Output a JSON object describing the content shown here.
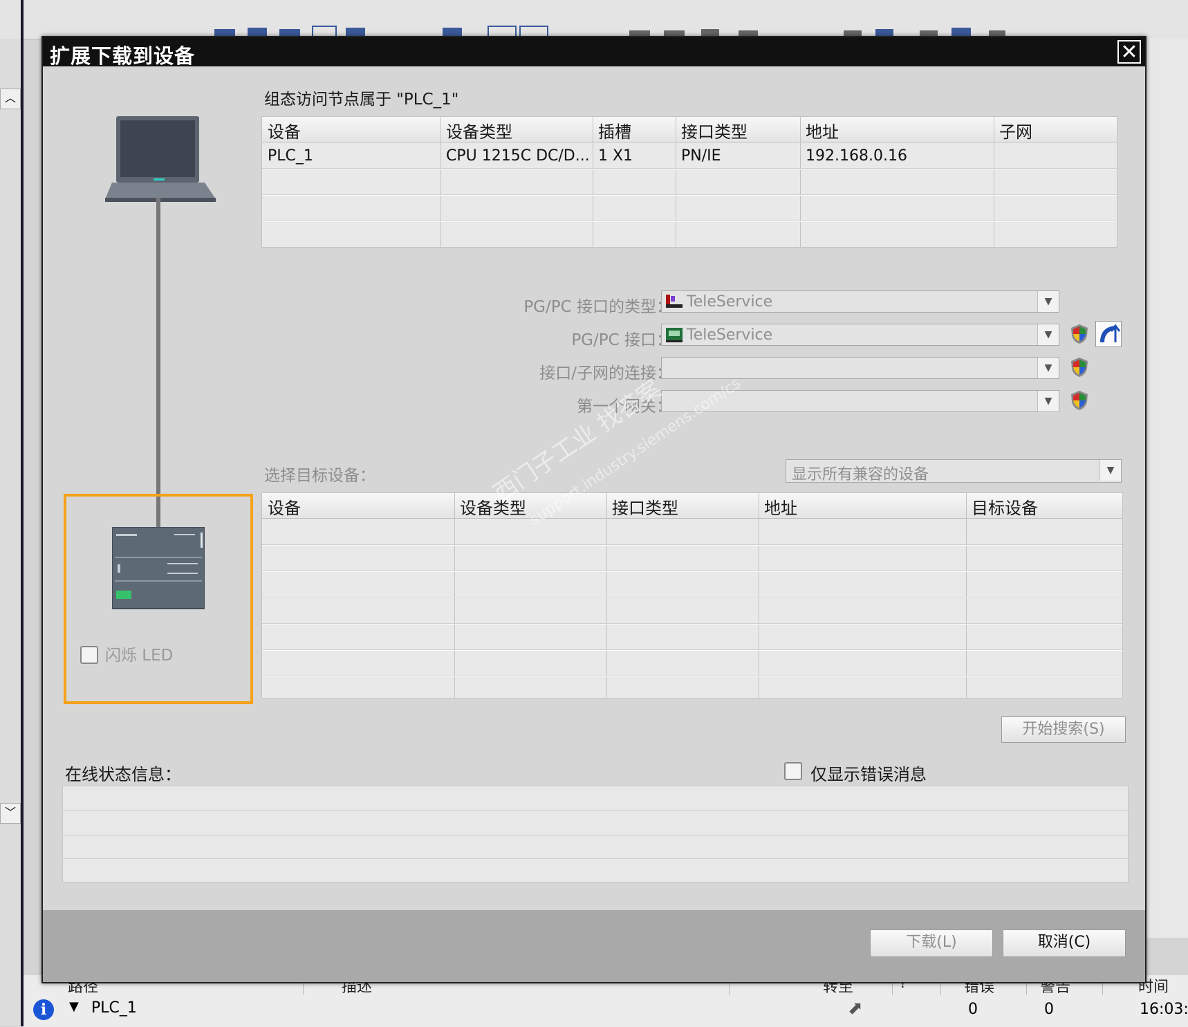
{
  "dialog": {
    "title": "扩展下载到设备",
    "close_glyph": "✕"
  },
  "config_section": {
    "heading": "组态访问节点属于 \"PLC_1\"",
    "columns": [
      "设备",
      "设备类型",
      "插槽",
      "接口类型",
      "地址",
      "子网"
    ],
    "rows": [
      [
        "PLC_1",
        "CPU 1215C DC/D...",
        "1 X1",
        "PN/IE",
        "192.168.0.16",
        ""
      ]
    ]
  },
  "interface": {
    "pgpc_type_label": "PG/PC 接口的类型：",
    "pgpc_type_value": "TeleService",
    "pgpc_label": "PG/PC 接口：",
    "pgpc_value": "TeleService",
    "subnet_label": "接口/子网的连接：",
    "subnet_value": "",
    "gateway_label": "第一个网关：",
    "gateway_value": ""
  },
  "target_section": {
    "label": "选择目标设备：",
    "filter_value": "显示所有兼容的设备",
    "columns": [
      "设备",
      "设备类型",
      "接口类型",
      "地址",
      "目标设备"
    ],
    "rows": []
  },
  "plc_panel": {
    "led_label": "闪烁 LED"
  },
  "search_button": "开始搜索(S)",
  "online_section": {
    "label": "在线状态信息：",
    "errors_only_label": "仅显示错误消息"
  },
  "footer": {
    "download_button": "下载(L)",
    "cancel_button": "取消(C)"
  },
  "watermark": {
    "line1": "西门子工业 找答案",
    "line2": "support.industry.siemens.com/cs"
  },
  "background": {
    "bottom_headers": [
      "路径",
      "描述",
      "转至",
      "?",
      "错误",
      "警告",
      "时间"
    ],
    "bottom_row": {
      "name": "PLC_1",
      "errors": "0",
      "warnings": "0",
      "time": "16:03:"
    }
  },
  "icons": [
    "laptop-icon",
    "plc-device-icon",
    "teleservice-icon",
    "security-shield-icon",
    "connect-modem-icon",
    "info-icon",
    "goto-arrow-icon"
  ],
  "colors": {
    "highlight_frame": "#f5a21b",
    "titlebar": "#111111",
    "dialog_bg": "#d6d6d6"
  }
}
